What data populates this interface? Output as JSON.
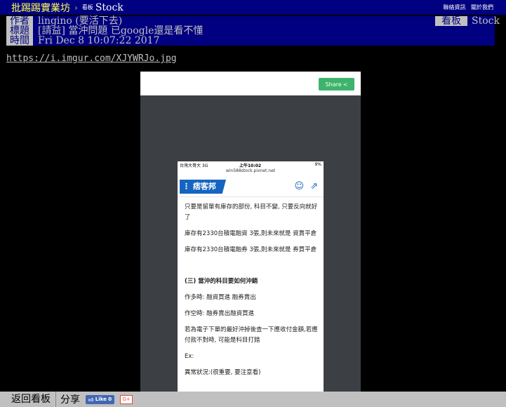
{
  "header": {
    "board_name": "批踢踢實業坊",
    "separator": "›",
    "board_label": "看板",
    "board_title": "Stock",
    "links": [
      "聯絡資訊",
      "關於我們"
    ]
  },
  "meta": {
    "author_tag": "作者",
    "author": "lingino (要活下去)",
    "title_tag": "標題",
    "title": "[請益] 當沖問題 已google還是看不懂",
    "time_tag": "時間",
    "time": "Fri Dec  8 10:07:22 2017",
    "board_tag": "看板",
    "board": "Stock"
  },
  "link": "https://i.imgur.com/XJYWRJo.jpg",
  "image": {
    "share_label": "Share",
    "phone": {
      "carrier": "台灣大哥大  3G",
      "time": "上午10:02",
      "battery": "9%",
      "url": "win588stock.pixnet.net",
      "logo": "痞客邦",
      "paragraphs": [
        "只要是留單有庫存的部份, 科目不變, 只要反向就好了",
        "庫存有2330台積電融資 3張,則未來就是  資賣平倉",
        "庫存有2330台積電融券 3張,則未來就是 券買平倉",
        "(三) 當沖的科目要如何沖銷",
        "作多時:  融資買進  融券賣出",
        "作空時:  融券賣出融資買進",
        "若為電子下單的最好沖掉後查一下應收付金額,若應付款不對時, 可能是科目打錯",
        "Ex:",
        "異常狀況:(很重要, 要注意看)"
      ]
    }
  },
  "footer": {
    "back_label": "返回看板",
    "share_label": "分享",
    "like_label": "Like 0",
    "gplus_label": "G+"
  }
}
